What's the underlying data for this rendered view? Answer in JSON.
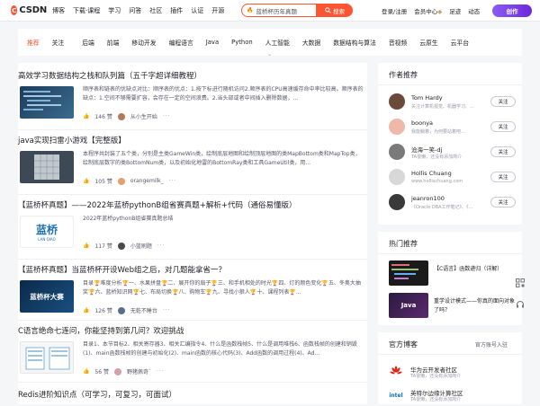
{
  "header": {
    "logo_text": "CSDN",
    "logo_mark": "C",
    "nav": [
      "博客",
      "下载·课程",
      "学习",
      "问答",
      "社区",
      "插件",
      "认证",
      "开源"
    ],
    "search_value": "蓝桥杯历年真题",
    "search_button": "搜索",
    "login": "登录/注册",
    "vip": "会员中心",
    "footprint": "足迹",
    "activity": "动态",
    "create_button": "创作"
  },
  "categories": [
    "推荐",
    "关注",
    "后端",
    "前端",
    "移动开发",
    "编程语言",
    "Java",
    "Python",
    "人工智能",
    "大数据",
    "数据结构与算法",
    "音视频",
    "云原生",
    "云平台"
  ],
  "articles": [
    {
      "title": "高效学习数据结构之栈和队列篇（五千字超详细教程）",
      "desc": "顺序表和链表的优缺点对比：顺序表的优点：1.按下标进行随机访问2.顺序表的CPU高速缓存命中率比较高。顺序表的缺点：1.空间不够需要扩容，会存在一定的空间浪费。2.当头部或者中间插入删除数据，...",
      "likes": "146 赞",
      "author": "从小生开始",
      "more": "···"
    },
    {
      "title": "java实现扫雷小游戏【完整版】",
      "desc": "本程序共封装了五个类，分别是主类GameWin类，绘制底层地图和绘制顶层地图的类MapBottom类和MapTop类，绘制底层数字的类BottomNum类，以及初始化地雷的BottomRay类和工具GameUtil类，用...",
      "likes": "105 赞",
      "author": "orangemilk_",
      "more": "···"
    },
    {
      "title": "【蓝桥杯真题】——2022年蓝桥pythonB组省赛真题+解析+代码（通俗易懂版）",
      "desc": "2022年蓝桥pythonB组省赛真题总结",
      "likes": "117 赞",
      "author": "小蓝刷题",
      "more": "···",
      "thumb_text": "蓝桥",
      "thumb_sub": "LAN QIAO"
    },
    {
      "title": "【蓝桥杯真题】当蓝桥杯开设Web组之后，对几题能拿省一？",
      "desc": "目录🏆难度分析🏆一、水果拼盘🏆二、展开你的扇子🏆三、和手机相处的时光🏆四、灯的颜色变化🏆五、冬奥大抽奖🏆六、蓝桥知识网🏆七、布局切换🏆八、购物车🏆九、寻找小狼人🏆十、课程列表🏆...",
      "likes": "126 赞",
      "author": "无乾不睡台",
      "more": "···",
      "thumb_text": "蓝桥杯大赛"
    },
    {
      "title": "C语言绝命七连问，你能坚持到第几问？欢迎挑战",
      "desc": "目录1、本节目标2、相关寄存器3、相关汇编指令4、什么是函数栈帧5、什么是调用堆栈6、函数栈帧的创建和销毁(1)、main函数栈帧的创建与初始化(2)、main函数的核心代码(3)、Add函数的调用过程(4)、Ad...",
      "likes": "56 赞",
      "author": "野猪佩奇`",
      "more": "···"
    },
    {
      "title": "Redis进阶知识点（可学习，可复习，可面试）"
    }
  ],
  "sidebar": {
    "authors_title": "作者推荐",
    "follow_label": "关注",
    "authors": [
      {
        "name": "Tom Hardy",
        "desc": "关注计算机视觉、机器学习、..."
      },
      {
        "name": "boonya",
        "desc": "我能躺着，为何要站着吧..."
      },
      {
        "name": "沧海一笑-dj",
        "desc": "TA很懒，还没有添加简介"
      },
      {
        "name": "Hollis Chuang",
        "desc": "www.hollischuang.com"
      },
      {
        "name": "jeanron100",
        "desc": "《Oracle DBA工作笔记》、《..."
      }
    ],
    "hot_title": "热门推荐",
    "hot": [
      {
        "title": "【C语言】函数递归（详解）"
      },
      {
        "title": "重学设计模式——你真的面向对象了吗？",
        "img_text": "Java"
      }
    ],
    "official_title": "官方博客",
    "official_more": "官方账号入驻",
    "official": [
      {
        "name": "华为云开发者社区",
        "desc": "TA很懒，还没有添加简介"
      },
      {
        "name": "英特尔边缘计算社区",
        "desc": "TA很懒，还没有添加简介",
        "logo_text": "intel"
      }
    ]
  },
  "colors": {
    "brand": "#fc5531",
    "vip_gold": "#c9a36b"
  }
}
